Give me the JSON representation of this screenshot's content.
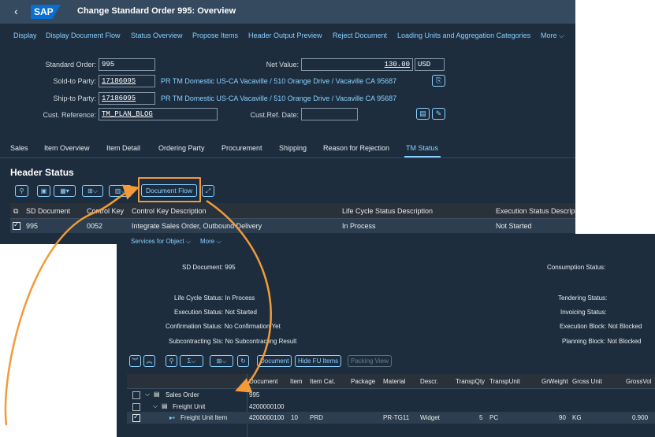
{
  "app": {
    "title": "Change Standard Order 995: Overview",
    "logo": "SAP",
    "back_icon": "back-chevron-icon"
  },
  "toolbar": {
    "items": [
      "Display",
      "Display Document Flow",
      "Status Overview",
      "Propose Items",
      "Header Output Preview",
      "Reject Document",
      "Loading Units and Aggregation Categories"
    ],
    "more": "More"
  },
  "header_fields": {
    "standard_order_label": "Standard Order:",
    "standard_order_value": "995",
    "net_value_label": "Net Value:",
    "net_value": "130.00",
    "currency": "USD",
    "sold_to_label": "Sold-to Party:",
    "sold_to_value": "17186095",
    "sold_to_desc": "PR TM Domestic US-CA Vacaville / 510 Orange Drive / Vacaville CA 95687",
    "ship_to_label": "Ship-to Party:",
    "ship_to_value": "17186095",
    "ship_to_desc": "PR TM Domestic US-CA Vacaville / 510 Orange Drive / Vacaville CA 95687",
    "cust_ref_label": "Cust. Reference:",
    "cust_ref_value": "TM_PLAN_BLOG",
    "cust_ref_date_label": "Cust.Ref. Date:",
    "cust_ref_date_value": ""
  },
  "tabs": [
    "Sales",
    "Item Overview",
    "Item Detail",
    "Ordering Party",
    "Procurement",
    "Shipping",
    "Reason for Rejection",
    "TM Status"
  ],
  "active_tab": "TM Status",
  "header_status": {
    "title": "Header Status",
    "document_flow_button": "Document Flow",
    "columns": [
      "SD Document",
      "Control Key",
      "Control Key Description",
      "Life Cycle Status Description",
      "Execution Status Descrip"
    ],
    "row": {
      "sd_document": "995",
      "control_key": "0052",
      "control_key_description": "Integrate Sales Order, Outbound Delivery",
      "life_cycle": "In Process",
      "execution": "Not Started"
    }
  },
  "doc_flow": {
    "menu": {
      "services": "Services for Object",
      "more": "More"
    },
    "sd_document": "SD Document: 995",
    "consumption_status": "Consumption Status:",
    "left_statuses": [
      "Life Cycle Status: In Process",
      "Execution Status: Not Started",
      "Confirmation Status: No Confirmation Yet",
      "Subcontracting Sts: No Subcontracting Result"
    ],
    "right_statuses": [
      "Tendering Status:",
      "Invoicing Status:",
      "Execution Block: Not Blocked",
      "Planning Block: Not Blocked"
    ],
    "buttons": {
      "document": "Document",
      "hide_fu_items": "Hide FU Items",
      "packing_view": "Packing View"
    },
    "columns": [
      "Document",
      "Item",
      "Item Cat.",
      "Package",
      "Material",
      "Descr.",
      "TranspQty",
      "TranspUnit",
      "GrWeight",
      "Gross Unit",
      "GrossVol"
    ],
    "rows": [
      {
        "name": "Sales Order",
        "document": "995",
        "item": "",
        "item_cat": "",
        "package": "",
        "material": "",
        "descr": "",
        "qty": "",
        "unit": "",
        "weight": "",
        "gross_unit": "",
        "vol": ""
      },
      {
        "name": "Freight Unit",
        "document": "4200000100",
        "item": "",
        "item_cat": "",
        "package": "",
        "material": "",
        "descr": "",
        "qty": "",
        "unit": "",
        "weight": "",
        "gross_unit": "",
        "vol": ""
      },
      {
        "name": "Freight Unit Item",
        "document": "4200000100",
        "item": "10",
        "item_cat": "PRD",
        "package": "",
        "material": "PR-TG11",
        "descr": "Widget",
        "qty": "5",
        "unit": "PC",
        "weight": "90",
        "gross_unit": "KG",
        "vol": "0.900"
      }
    ]
  },
  "colors": {
    "shell": "#354a5f",
    "background": "#1d2d3e",
    "link": "#89d1ff",
    "highlight": "#f29b38"
  }
}
